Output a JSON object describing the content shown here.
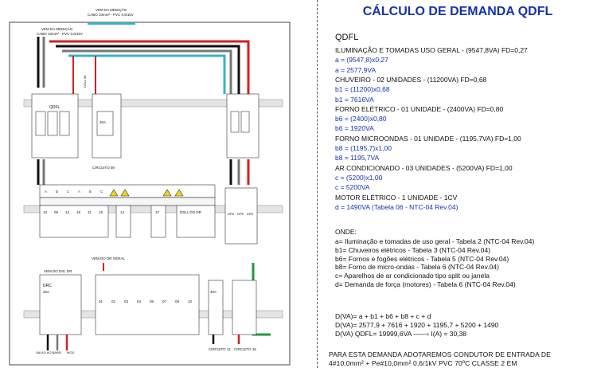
{
  "schematic": {
    "top_feed_label": "VEM DA MEDIÇÃO",
    "top_feed_cable": "CABO 10mm² - PVC 0,6/1kV",
    "second_feed_label": "VEM DA MEDIÇÃO",
    "second_feed_cable": "CABO 10mm² - PVC 0,6/1kV",
    "qdfl_label": "QDFL",
    "dsl_label": "DSLL 68",
    "breaker_top_rating": "20A",
    "circuit_08_label": "CIRCUITO 08",
    "phase_letters": [
      "A",
      "B",
      "C",
      "A",
      "B",
      "C"
    ],
    "circuit_numbers": [
      "13",
      "06",
      "12",
      "16",
      "11",
      "15"
    ],
    "circuit_14_label": "14",
    "circuit_17_label": "17",
    "dsl_dr_label": "DSLL DO DR",
    "dps_labels": [
      "DPS",
      "DPS",
      "DPS"
    ],
    "vem_dr_label": "VEM DO DR GERAL",
    "vem_dsl_label": "VEM DO DSL DR",
    "drc_label": "DRC",
    "drc_rating": "25A",
    "lower_circuits": [
      "01",
      "02",
      "03",
      "04",
      "05",
      "07",
      "09",
      "10"
    ],
    "circuit_11_label": "CIRCUITO 11",
    "circuit_16_label": "CIRCUITO 16",
    "rating_40a": "40A",
    "bottom_labels": [
      "VAI AO AO BARR.",
      "MOD"
    ]
  },
  "calc": {
    "title": "CÁLCULO DE DEMANDA QDFL",
    "heading": "QDFL",
    "lines": [
      {
        "t": "ILUMINAÇÃO E TOMADAS USO GERAL - (9547,8VA) FD=0,27",
        "c": "k"
      },
      {
        "t": "a = (9547,8)x0,27",
        "c": "b"
      },
      {
        "t": "a = 2577,9VA",
        "c": "b"
      },
      {
        "t": "CHUVEIRO - 02 UNIDADES - (11200VA) FD=0,68",
        "c": "k"
      },
      {
        "t": "b1 = (11200)x0,68",
        "c": "b"
      },
      {
        "t": "b1 = 7616VA",
        "c": "b"
      },
      {
        "t": "FORNO ELÉTRICO - 01 UNIDADE - (2400VA) FD=0,80",
        "c": "k"
      },
      {
        "t": "b6 = (2400)x0,80",
        "c": "b"
      },
      {
        "t": "b6 = 1920VA",
        "c": "b"
      },
      {
        "t": "FORNO MICROONDAS - 01 UNIDADE - (1195,7VA) FD=1,00",
        "c": "k"
      },
      {
        "t": "b8 = (1195,7)x1,00",
        "c": "b"
      },
      {
        "t": "b8 = 1195,7VA",
        "c": "b"
      },
      {
        "t": "AR CONDICIONADO - 03 UNIDADES - (5200VA) FD=1,00",
        "c": "k"
      },
      {
        "t": "c = (5200)x1,00",
        "c": "b"
      },
      {
        "t": "c = 5200VA",
        "c": "b"
      },
      {
        "t": " MOTOR ELÉTRICO - 1 UNIDADE  - 1CV",
        "c": "k"
      },
      {
        "t": "d = 1490VA (Tabela 06 - NTC-04 Rev.04)",
        "c": "b"
      }
    ],
    "onde_heading": "ONDE:",
    "onde": [
      "a=  Iluminação e tomadas de uso geral - Tabela 2 (NTC-04 Rev.04)",
      "b1= Chuveiros elétricos - Tabela 3 (NTC-04 Rev.04)",
      "b6= Fornos e fogões elétricos - Tabela 5 (NTC-04 Rev.04)",
      "b8= Forno de micro-ondas - Tabela 6 (NTC-04 Rev.04)",
      "c=  Aparelhos de ar condicionado tipo split ou janela",
      "d=  Demanda de força (motores) - Tabela 6 (NTC-04 Rev.04)"
    ],
    "formulas": [
      "D(VA)= a + b1 + b6 + b8 + c + d",
      "D(VA)= 2577,9 + 7616 + 1920 + 1195,7 + 5200 + 1490",
      "D(VA) QDFL= 19999,6VA     ——›  I(A) = 30,38"
    ],
    "conclusion": [
      "PARA ESTA DEMANDA ADOTAREMOS CONDUTOR DE ENTRADA DE",
      "4#10,0mm²   +   Pe#10,0mm²   0,6/1kV   PVC   70ºC   CLASSE  2  EM"
    ]
  }
}
